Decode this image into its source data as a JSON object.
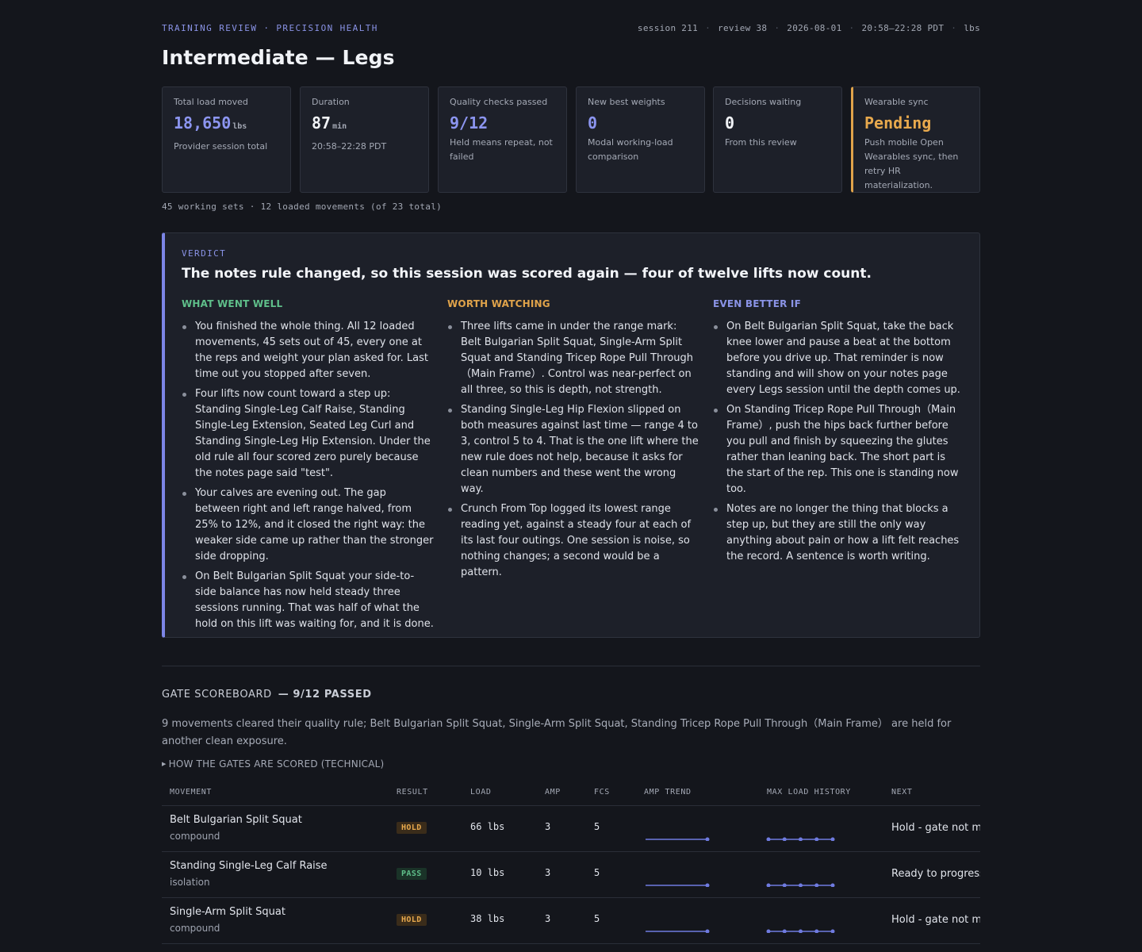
{
  "header": {
    "eyebrow": "TRAINING REVIEW · PRECISION HEALTH",
    "meta": [
      "session 211",
      "review 38",
      "2026-08-01",
      "20:58–22:28 PDT",
      "lbs"
    ],
    "title": "Intermediate — Legs"
  },
  "stats": [
    {
      "label": "Total load moved",
      "value": "18,650",
      "unit": "lbs",
      "note": "Provider session total",
      "style": "accent"
    },
    {
      "label": "Duration",
      "value": "87",
      "unit": "min",
      "note": "20:58–22:28 PDT",
      "style": ""
    },
    {
      "label": "Quality checks passed",
      "value": "9/12",
      "unit": "",
      "note": "Held means repeat, not failed",
      "style": "accent"
    },
    {
      "label": "New best weights",
      "value": "0",
      "unit": "",
      "note": "Modal working-load comparison",
      "style": "accent"
    },
    {
      "label": "Decisions waiting",
      "value": "0",
      "unit": "",
      "note": "From this review",
      "style": ""
    },
    {
      "label": "Wearable sync",
      "value": "Pending",
      "unit": "",
      "note": "Push mobile Open Wearables sync, then retry HR materialization.",
      "style": "amber"
    }
  ],
  "subline": "45 working sets · 12 loaded movements (of 23 total)",
  "verdict": {
    "eyebrow": "VERDICT",
    "headline": "The notes rule changed, so this session was scored again — four of twelve lifts now count.",
    "columns": [
      {
        "heading": "WHAT WENT WELL",
        "items": [
          "You finished the whole thing. All 12 loaded movements, 45 sets out of 45, every one at the reps and weight your plan asked for. Last time out you stopped after seven.",
          "Four lifts now count toward a step up: Standing Single-Leg Calf Raise, Standing Single-Leg Extension, Seated Leg Curl and Standing Single-Leg Hip Extension. Under the old rule all four scored zero purely because the notes page said \"test\".",
          "Your calves are evening out. The gap between right and left range halved, from 25% to 12%, and it closed the right way: the weaker side came up rather than the stronger side dropping.",
          "On Belt Bulgarian Split Squat your side-to-side balance has now held steady three sessions running. That was half of what the hold on this lift was waiting for, and it is done."
        ]
      },
      {
        "heading": "WORTH WATCHING",
        "items": [
          "Three lifts came in under the range mark: Belt Bulgarian Split Squat, Single-Arm Split Squat and Standing Tricep Rope Pull Through（Main Frame）. Control was near-perfect on all three, so this is depth, not strength.",
          "Standing Single-Leg Hip Flexion slipped on both measures against last time — range 4 to 3, control 5 to 4. That is the one lift where the new rule does not help, because it asks for clean numbers and these went the wrong way.",
          "Crunch From Top logged its lowest range reading yet, against a steady four at each of its last four outings. One session is noise, so nothing changes; a second would be a pattern."
        ]
      },
      {
        "heading": "EVEN BETTER IF",
        "items": [
          "On Belt Bulgarian Split Squat, take the back knee lower and pause a beat at the bottom before you drive up. That reminder is now standing and will show on your notes page every Legs session until the depth comes up.",
          "On Standing Tricep Rope Pull Through（Main Frame）, push the hips back further before you pull and finish by squeezing the glutes rather than leaning back. The short part is the start of the rep. This one is standing now too.",
          "Notes are no longer the thing that blocks a step up, but they are still the only way anything about pain or how a lift felt reaches the record. A sentence is worth writing."
        ]
      }
    ]
  },
  "gates": {
    "heading": "GATE SCOREBOARD",
    "count": "— 9/12 PASSED",
    "description": "9 movements cleared their quality rule; Belt Bulgarian Split Squat, Single-Arm Split Squat, Standing Tricep Rope Pull Through（Main Frame） are held for another clean exposure.",
    "technical": "HOW THE GATES ARE SCORED (TECHNICAL)",
    "columns": [
      "MOVEMENT",
      "RESULT",
      "LOAD",
      "AMP",
      "FCS",
      "AMP TREND",
      "MAX LOAD HISTORY",
      "NEXT"
    ],
    "rows": [
      {
        "movement": "Belt Bulgarian Split Squat",
        "type": "compound",
        "result": "HOLD",
        "load": "66 lbs",
        "amp": "3",
        "fcs": "5",
        "amp_trend": [
          3,
          3
        ],
        "max_load_history": [
          66,
          66,
          66,
          66,
          66
        ],
        "next": "Hold - gate not met"
      },
      {
        "movement": "Standing Single-Leg Calf Raise",
        "type": "isolation",
        "result": "PASS",
        "load": "10 lbs",
        "amp": "3",
        "fcs": "5",
        "amp_trend": [
          3,
          3
        ],
        "max_load_history": [
          10,
          10,
          10,
          10,
          10
        ],
        "next": "Ready to progress"
      },
      {
        "movement": "Single-Arm Split Squat",
        "type": "compound",
        "result": "HOLD",
        "load": "38 lbs",
        "amp": "3",
        "fcs": "5",
        "amp_trend": [
          3,
          3
        ],
        "max_load_history": [
          38,
          38,
          38,
          38,
          38
        ],
        "next": "Hold - gate not met"
      }
    ]
  },
  "colors": {
    "accent": "#8c95f0",
    "amber": "#e8a94d",
    "green": "#5fbf8a",
    "spark": "#6f7be0"
  }
}
